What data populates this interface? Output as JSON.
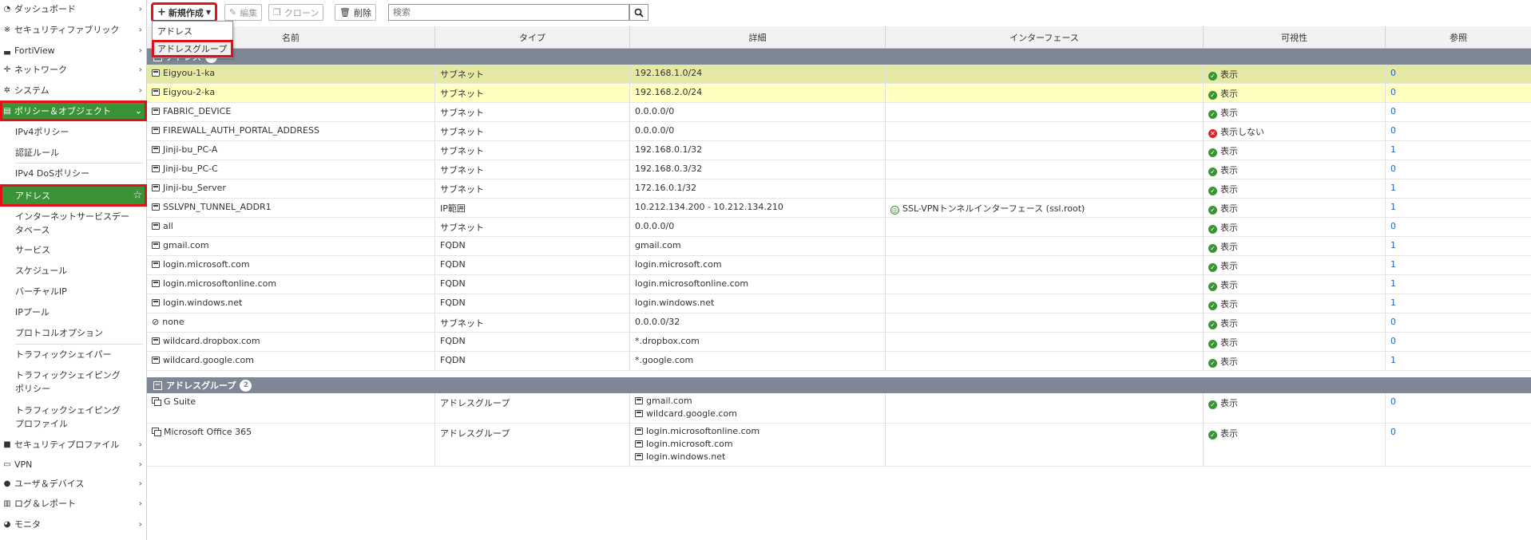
{
  "sidebar": {
    "items": [
      {
        "label": "ダッシュボード",
        "icon": "dashboard-icon"
      },
      {
        "label": "セキュリティファブリック",
        "icon": "fabric-icon"
      },
      {
        "label": "FortiView",
        "icon": "chart-icon"
      },
      {
        "label": "ネットワーク",
        "icon": "network-icon"
      },
      {
        "label": "システム",
        "icon": "gear-icon"
      },
      {
        "label": "ポリシー＆オブジェクト",
        "icon": "policy-icon"
      },
      {
        "label": "セキュリティプロファイル",
        "icon": "lock-icon"
      },
      {
        "label": "VPN",
        "icon": "monitor-icon"
      },
      {
        "label": "ユーザ＆デバイス",
        "icon": "user-icon"
      },
      {
        "label": "ログ＆レポート",
        "icon": "bar-chart-icon"
      },
      {
        "label": "モニタ",
        "icon": "pie-icon"
      }
    ],
    "policy_subitems": [
      "IPv4ポリシー",
      "認証ルール",
      "IPv4 DoSポリシー",
      "アドレス",
      "インターネットサービスデータベース",
      "サービス",
      "スケジュール",
      "バーチャルIP",
      "IPプール",
      "プロトコルオプション",
      "トラフィックシェイパー",
      "トラフィックシェイピングポリシー",
      "トラフィックシェイピングプロファイル"
    ],
    "chevron": "›",
    "expanded_chevron": "⌄",
    "star": "☆"
  },
  "toolbar": {
    "new_label": "新規作成",
    "edit_label": "編集",
    "clone_label": "クローン",
    "delete_label": "削除",
    "search_placeholder": "検索"
  },
  "dropdown": {
    "items": [
      "アドレス",
      "アドレスグループ"
    ]
  },
  "table": {
    "columns": [
      "名前",
      "タイプ",
      "詳細",
      "インターフェース",
      "可視性",
      "参照"
    ],
    "groups": [
      {
        "label": "アドレス",
        "count": "18"
      },
      {
        "label": "アドレスグループ",
        "count": "2"
      }
    ],
    "address_rows": [
      {
        "name": "Eigyou-1-ka",
        "type": "サブネット",
        "detail": "192.168.1.0/24",
        "iface": "",
        "visibility": "表示",
        "ref": "0"
      },
      {
        "name": "Eigyou-2-ka",
        "type": "サブネット",
        "detail": "192.168.2.0/24",
        "iface": "",
        "visibility": "表示",
        "ref": "0"
      },
      {
        "name": "FABRIC_DEVICE",
        "type": "サブネット",
        "detail": "0.0.0.0/0",
        "iface": "",
        "visibility": "表示",
        "ref": "0"
      },
      {
        "name": "FIREWALL_AUTH_PORTAL_ADDRESS",
        "type": "サブネット",
        "detail": "0.0.0.0/0",
        "iface": "",
        "visibility": "表示しない",
        "ref": "0"
      },
      {
        "name": "Jinji-bu_PC-A",
        "type": "サブネット",
        "detail": "192.168.0.1/32",
        "iface": "",
        "visibility": "表示",
        "ref": "1"
      },
      {
        "name": "Jinji-bu_PC-C",
        "type": "サブネット",
        "detail": "192.168.0.3/32",
        "iface": "",
        "visibility": "表示",
        "ref": "0"
      },
      {
        "name": "Jinji-bu_Server",
        "type": "サブネット",
        "detail": "172.16.0.1/32",
        "iface": "",
        "visibility": "表示",
        "ref": "1"
      },
      {
        "name": "SSLVPN_TUNNEL_ADDR1",
        "type": "IP範囲",
        "detail": "10.212.134.200 - 10.212.134.210",
        "iface": "SSL-VPNトンネルインターフェース (ssl.root)",
        "visibility": "表示",
        "ref": "1"
      },
      {
        "name": "all",
        "type": "サブネット",
        "detail": "0.0.0.0/0",
        "iface": "",
        "visibility": "表示",
        "ref": "0"
      },
      {
        "name": "gmail.com",
        "type": "FQDN",
        "detail": "gmail.com",
        "iface": "",
        "visibility": "表示",
        "ref": "1"
      },
      {
        "name": "login.microsoft.com",
        "type": "FQDN",
        "detail": "login.microsoft.com",
        "iface": "",
        "visibility": "表示",
        "ref": "1"
      },
      {
        "name": "login.microsoftonline.com",
        "type": "FQDN",
        "detail": "login.microsoftonline.com",
        "iface": "",
        "visibility": "表示",
        "ref": "1"
      },
      {
        "name": "login.windows.net",
        "type": "FQDN",
        "detail": "login.windows.net",
        "iface": "",
        "visibility": "表示",
        "ref": "1"
      },
      {
        "name": "none",
        "type": "サブネット",
        "detail": "0.0.0.0/32",
        "iface": "",
        "visibility": "表示",
        "ref": "0"
      },
      {
        "name": "wildcard.dropbox.com",
        "type": "FQDN",
        "detail": "*.dropbox.com",
        "iface": "",
        "visibility": "表示",
        "ref": "0"
      },
      {
        "name": "wildcard.google.com",
        "type": "FQDN",
        "detail": "*.google.com",
        "iface": "",
        "visibility": "表示",
        "ref": "1"
      }
    ],
    "group_rows": [
      {
        "name": "G Suite",
        "type": "アドレスグループ",
        "members": [
          "gmail.com",
          "wildcard.google.com"
        ],
        "visibility": "表示",
        "ref": "0"
      },
      {
        "name": "Microsoft Office 365",
        "type": "アドレスグループ",
        "members": [
          "login.microsoftonline.com",
          "login.microsoft.com",
          "login.windows.net"
        ],
        "visibility": "表示",
        "ref": "0"
      }
    ]
  },
  "colors": {
    "active_green": "#3a9336",
    "highlight_red": "#e3101a",
    "group_header": "#7e8796",
    "link_blue": "#1f66c2"
  }
}
